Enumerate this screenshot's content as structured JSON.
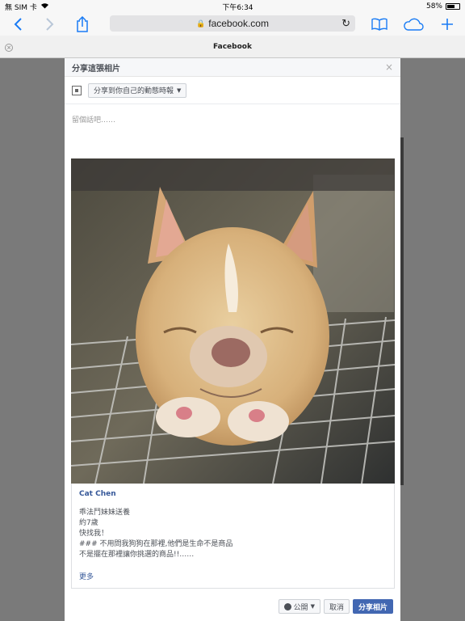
{
  "status": {
    "carrier": "無 SIM 卡",
    "time": "下午6:34",
    "battery": "58%",
    "battery_level": 0.58
  },
  "browser": {
    "url": "facebook.com",
    "tab_title": "Facebook"
  },
  "dialog": {
    "title": "分享這張相片",
    "share_target": "分享到你自己的動態時報",
    "comment_placeholder": "留個話吧……",
    "post": {
      "author": "Cat Chen",
      "lines": [
        "乖法鬥妹妹送養",
        "約7歲",
        "快找我！",
        "### 不用問我狗狗在那裡,他們是生命不是商品",
        "不是擺在那裡讓你挑選的商品!!……"
      ],
      "more": "更多"
    },
    "privacy_label": "公開",
    "cancel_label": "取消",
    "share_label": "分享相片"
  }
}
